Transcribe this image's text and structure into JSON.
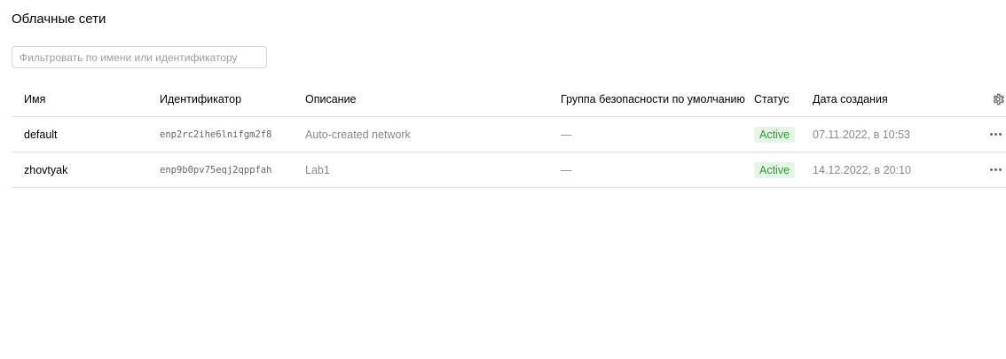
{
  "page": {
    "title": "Облачные сети"
  },
  "filter": {
    "placeholder": "Фильтровать по имени или идентификатору",
    "value": ""
  },
  "table": {
    "columns": {
      "name": "Имя",
      "id": "Идентификатор",
      "description": "Описание",
      "security_group": "Группа безопасности по умолчанию",
      "status": "Статус",
      "created": "Дата создания"
    },
    "settings_icon": "gear-icon",
    "rows": [
      {
        "name": "default",
        "id": "enp2rc2ihe6lnifgm2f8",
        "description": "Auto-created network",
        "security_group": "—",
        "status": "Active",
        "created": "07.11.2022, в 10:53"
      },
      {
        "name": "zhovtyak",
        "id": "enp9b0pv75eqj2qppfah",
        "description": "Lab1",
        "security_group": "—",
        "status": "Active",
        "created": "14.12.2022, в 20:10"
      }
    ]
  },
  "colors": {
    "status_active_bg": "#e6f6e6",
    "status_active_text": "#2c9b2c",
    "divider": "#e6e6e6"
  }
}
